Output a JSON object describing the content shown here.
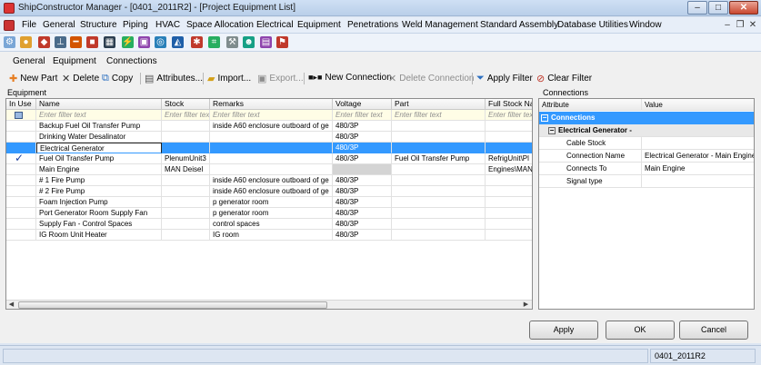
{
  "window": {
    "title": "ShipConstructor Manager - [0401_2011R2] - [Project Equipment List]"
  },
  "menu": [
    "File",
    "General",
    "Structure",
    "Piping",
    "HVAC",
    "Space Allocation",
    "Electrical",
    "Equipment",
    "Penetrations",
    "Weld Management",
    "Standard Assembly",
    "Database Utilities",
    "Window"
  ],
  "tabs": [
    "General",
    "Equipment",
    "Connections"
  ],
  "toolbar": {
    "new_part": "New Part",
    "delete": "Delete",
    "copy": "Copy",
    "attributes": "Attributes...",
    "import": "Import...",
    "export": "Export...",
    "new_connection": "New Connection",
    "delete_connection": "Delete Connection",
    "apply_filter": "Apply Filter",
    "clear_filter": "Clear Filter"
  },
  "equipment": {
    "label": "Equipment",
    "columns": [
      "In Use",
      "Name",
      "Stock",
      "Remarks",
      "Voltage",
      "Part",
      "Full Stock Na"
    ],
    "filter_placeholder": "Enter filter text",
    "filter_stock": "Enter filter tex",
    "rows": [
      {
        "in_use": "",
        "name": "Backup Fuel Oil Transfer Pump",
        "stock": "",
        "remarks": "inside A60 enclosure outboard of ge",
        "voltage": "480/3P",
        "part": "",
        "full_stock": ""
      },
      {
        "in_use": "",
        "name": "Drinking Water Desalinator",
        "stock": "",
        "remarks": "",
        "voltage": "480/3P",
        "part": "",
        "full_stock": ""
      },
      {
        "in_use": "",
        "name": "Electrical Generator",
        "stock": "",
        "remarks": "",
        "voltage": "480/3P",
        "part": "",
        "full_stock": ""
      },
      {
        "in_use": "✓",
        "name": "Fuel Oil Transfer Pump",
        "stock": "PlenumUnit3",
        "remarks": "",
        "voltage": "480/3P",
        "part": "Fuel Oil Transfer Pump",
        "full_stock": "RefrigUnit\\Pl"
      },
      {
        "in_use": "",
        "name": "Main Engine",
        "stock": "MAN Deisel",
        "remarks": "",
        "voltage": "",
        "part": "",
        "full_stock": "Engines\\MAN"
      },
      {
        "in_use": "",
        "name": "# 1 Fire Pump",
        "stock": "",
        "remarks": "inside A60 enclosure outboard of ge",
        "voltage": "480/3P",
        "part": "",
        "full_stock": ""
      },
      {
        "in_use": "",
        "name": "# 2 Fire Pump",
        "stock": "",
        "remarks": "inside A60 enclosure outboard of ge",
        "voltage": "480/3P",
        "part": "",
        "full_stock": ""
      },
      {
        "in_use": "",
        "name": "Foam Injection Pump",
        "stock": "",
        "remarks": "p generator room",
        "voltage": "480/3P",
        "part": "",
        "full_stock": ""
      },
      {
        "in_use": "",
        "name": "Port Generator Room Supply Fan",
        "stock": "",
        "remarks": "p generator room",
        "voltage": "480/3P",
        "part": "",
        "full_stock": ""
      },
      {
        "in_use": "",
        "name": "Supply Fan - Control Spaces",
        "stock": "",
        "remarks": "control spaces",
        "voltage": "480/3P",
        "part": "",
        "full_stock": ""
      },
      {
        "in_use": "",
        "name": "IG Room Unit Heater",
        "stock": "",
        "remarks": "IG room",
        "voltage": "480/3P",
        "part": "",
        "full_stock": ""
      }
    ],
    "selected_row": 2
  },
  "connections": {
    "label": "Connections",
    "columns": [
      "Attribute",
      "Value"
    ],
    "group": "Connections",
    "subgroup": "Electrical Generator -",
    "rows": [
      {
        "attribute": "Cable Stock",
        "value": ""
      },
      {
        "attribute": "Connection Name",
        "value": "Electrical Generator - Main Engine"
      },
      {
        "attribute": "Connects To",
        "value": "Main Engine"
      },
      {
        "attribute": "Signal type",
        "value": ""
      }
    ]
  },
  "buttons": {
    "apply": "Apply",
    "ok": "OK",
    "cancel": "Cancel"
  },
  "status": {
    "project": "0401_2011R2"
  }
}
